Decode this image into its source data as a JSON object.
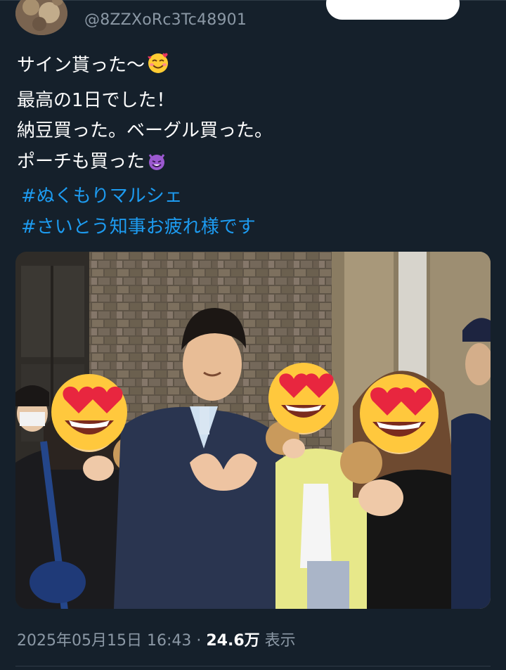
{
  "user": {
    "handle": "@8ZZXoRc3Tc48901"
  },
  "follow_button": {
    "label": ""
  },
  "tweet": {
    "lines": [
      "サイン貰った〜",
      "最高の1日でした！",
      "納豆買った。ベーグル買った。",
      "ポーチも買った"
    ],
    "hashtags": [
      "#ぬくもりマルシェ",
      "#さいとう知事お疲れ様です"
    ],
    "emojis": [
      "smiling-face-with-hearts",
      "smiling-imp"
    ]
  },
  "photo": {
    "faces_emoji": "heart-eyes"
  },
  "meta": {
    "date": "2025年05月15日 16:43",
    "separator": "·",
    "views_count": "24.6万",
    "views_label": "表示"
  },
  "colors": {
    "background": "#15202b",
    "text": "#ffffff",
    "muted": "#8b98a5",
    "link": "#1d9bf0",
    "divider": "#2f3b47"
  }
}
